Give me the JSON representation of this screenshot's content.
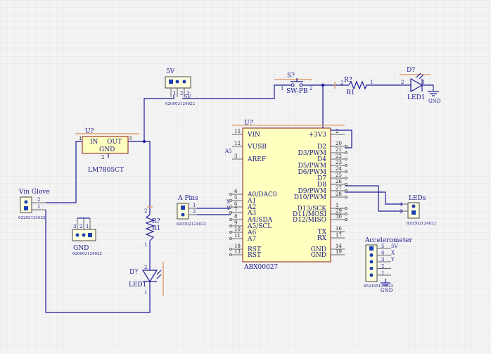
{
  "colors": {
    "wire": "#1a1a9a",
    "chip_fill": "#ffffc0",
    "chip_border": "#8a1a1a",
    "pin": "#666666",
    "text": "#1a1a8c",
    "grid": "#e2e2e2",
    "marker": "#e0a070",
    "background": "#f3f3f3"
  },
  "regulator": {
    "ref": "U?",
    "pin_in": "IN",
    "pin_out": "OUT",
    "pin_gnd": "GND",
    "num_1": "1",
    "num_3": "3",
    "num_2": "2",
    "part": "LM7805CT"
  },
  "mcu": {
    "ref": "U?",
    "part": "ABX00027",
    "left_pins": [
      {
        "num": "15",
        "name": "VIN"
      },
      {
        "num": "12",
        "name": "VUSB"
      },
      {
        "num": "3",
        "name": "AREF"
      },
      {
        "num": "4",
        "name": "A0/DAC0"
      },
      {
        "num": "5",
        "name": "A1"
      },
      {
        "num": "6",
        "name": "A2"
      },
      {
        "num": "7",
        "name": "A3"
      },
      {
        "num": "8",
        "name": "A4/SDA"
      },
      {
        "num": "9",
        "name": "A5/SCL"
      },
      {
        "num": "10",
        "name": "A6"
      },
      {
        "num": "11",
        "name": "A7"
      },
      {
        "num": "18",
        "name": "RST"
      },
      {
        "num": "13",
        "name": "RST"
      }
    ],
    "right_pins": [
      {
        "num": "2",
        "name": "+3V3"
      },
      {
        "num": "20",
        "name": "D2"
      },
      {
        "num": "21",
        "name": "D3/PWM"
      },
      {
        "num": "22",
        "name": "D4"
      },
      {
        "num": "23",
        "name": "D5/PWM"
      },
      {
        "num": "24",
        "name": "D6/PWM"
      },
      {
        "num": "25",
        "name": "D7"
      },
      {
        "num": "26",
        "name": "D8"
      },
      {
        "num": "27",
        "name": "D9/PWM"
      },
      {
        "num": "28",
        "name": "D10/PWM"
      },
      {
        "num": "1",
        "name": "D13/SCK"
      },
      {
        "num": "29",
        "name": "D11/MOSI"
      },
      {
        "num": "30",
        "name": "D12/MISO"
      },
      {
        "num": "16",
        "name": "TX"
      },
      {
        "num": "17",
        "name": "RX"
      },
      {
        "num": "14",
        "name": "GND"
      },
      {
        "num": "19",
        "name": "GND"
      }
    ]
  },
  "conn_5v": {
    "title": "5V",
    "pins": [
      "1",
      "2",
      "3"
    ],
    "code": "620003124022",
    "net": "5V"
  },
  "conn_vin": {
    "title": "Vin Glove",
    "pins": [
      "2",
      "1"
    ],
    "code": "62202124022"
  },
  "conn_gnd": {
    "title": "GND",
    "pins": [
      "3",
      "2",
      "1"
    ],
    "code": "620003124022"
  },
  "conn_apins": {
    "title": "A Pins",
    "pins": [
      "1",
      "2"
    ],
    "code": "620302124022"
  },
  "conn_leds": {
    "title": "LEDs",
    "pins": [
      "1",
      "2"
    ],
    "code": "620302124022"
  },
  "conn_accel": {
    "title": "Accelerometer",
    "pins": [
      "5",
      "4",
      "3",
      "2",
      "1"
    ],
    "nets": [
      "5V",
      "X",
      "Y",
      "",
      ""
    ],
    "code": "653105124022"
  },
  "switch": {
    "ref": "S?",
    "part": "SW-PB",
    "pin_1": "1",
    "pin_2": "2"
  },
  "r1_top": {
    "ref": "R?",
    "name": "R1",
    "pin_2": "2",
    "pin_1": "1"
  },
  "r1_left": {
    "ref": "R?",
    "name": "R1",
    "pin_2": "2",
    "pin_1": "1"
  },
  "led_top": {
    "ref": "D?",
    "name": "LED1",
    "pin_2": "2",
    "pin_1": "1",
    "gnd": "GND"
  },
  "led_left": {
    "ref": "D?",
    "name": "LED1",
    "pin_2": "2",
    "pin_1": "1"
  },
  "gnd_label": "GND",
  "net_labels": {
    "a5": "A5",
    "x": "X",
    "y": "Y"
  }
}
